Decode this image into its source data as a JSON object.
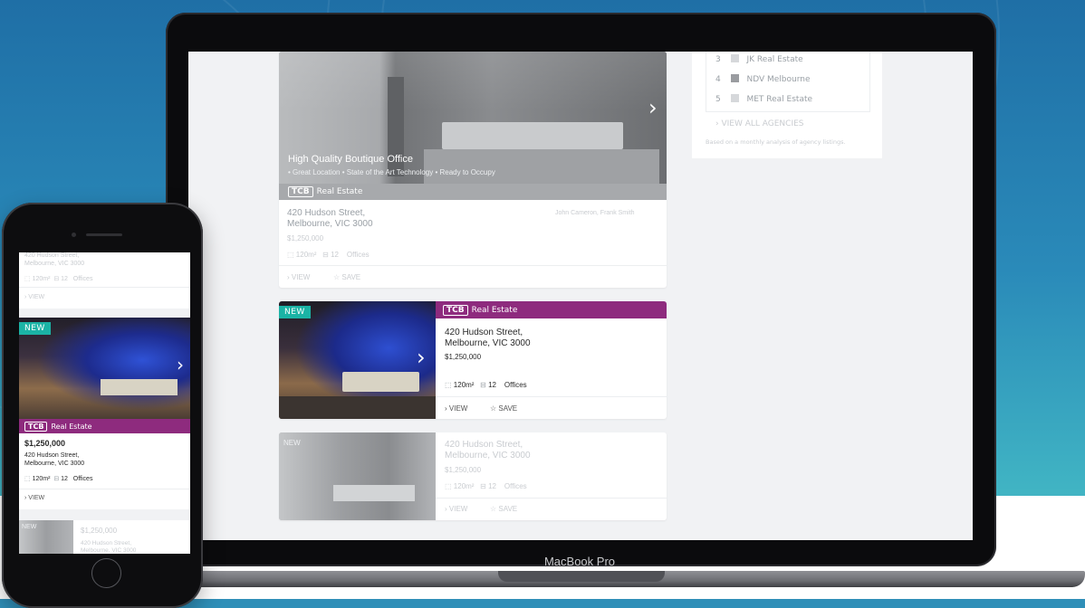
{
  "laptop": {
    "brand_label": "MacBook Pro",
    "side_panel": {
      "agencies": [
        {
          "rank": "3",
          "name": "JK Real Estate"
        },
        {
          "rank": "4",
          "name": "NDV Melbourne"
        },
        {
          "rank": "5",
          "name": "MET Real Estate"
        }
      ],
      "view_all": "› VIEW ALL AGENCIES",
      "footnote": "Based on a monthly analysis of agency listings."
    },
    "listings": [
      {
        "title": "High Quality Boutique Office",
        "features": "• Great Location  •  State of the Art Technology  •  Ready to Occupy",
        "agency_logo": "TCB",
        "agency_name": "Real Estate",
        "street": "420 Hudson Street,",
        "city": "Melbourne, VIC 3000",
        "price": "$1,250,000",
        "agents": "John Cameron, Frank Smith",
        "area": "120m²",
        "desks": "12",
        "type": "Offices",
        "view": "› VIEW",
        "save": "☆ SAVE"
      },
      {
        "badge": "NEW",
        "agency_logo": "TCB",
        "agency_name": "Real Estate",
        "street": "420 Hudson Street,",
        "city": "Melbourne, VIC 3000",
        "price": "$1,250,000",
        "area": "120m²",
        "desks": "12",
        "type": "Offices",
        "view": "› VIEW",
        "save": "☆ SAVE"
      },
      {
        "badge": "NEW",
        "street": "420 Hudson Street,",
        "city": "Melbourne, VIC 3000",
        "price": "$1,250,000",
        "area": "120m²",
        "desks": "12",
        "type": "Offices",
        "view": "› VIEW",
        "save": "☆ SAVE"
      }
    ]
  },
  "phone": {
    "top": {
      "street": "420 Hudson Street,",
      "city": "Melbourne, VIC 3000",
      "area": "120m²",
      "desks": "12",
      "type": "Offices",
      "view": "› VIEW"
    },
    "main": {
      "badge": "NEW",
      "agency_logo": "TCB",
      "agency_name": "Real Estate",
      "price": "$1,250,000",
      "street": "420 Hudson Street,",
      "city": "Melbourne, VIC 3000",
      "area": "120m²",
      "desks": "12",
      "type": "Offices",
      "view": "› VIEW"
    },
    "bottom": {
      "badge": "NEW",
      "price": "$1,250,000",
      "street": "420 Hudson Street,",
      "city": "Melbourne, VIC 3000"
    }
  },
  "colors": {
    "agency_purple": "#8e2b7e",
    "new_teal": "#1bb3a5"
  }
}
